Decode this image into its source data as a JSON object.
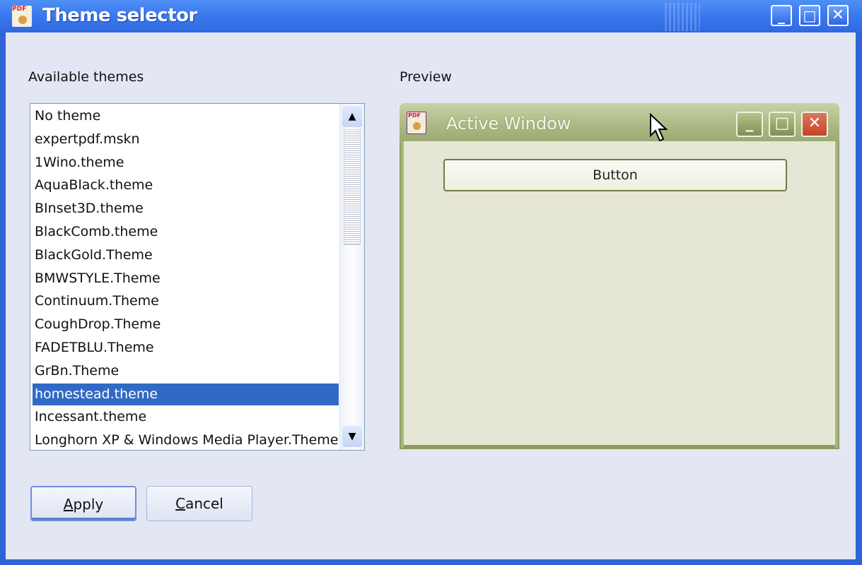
{
  "window": {
    "title": "Theme selector",
    "controls": {
      "minimize": "_",
      "maximize": "□",
      "close": "✕"
    }
  },
  "available_themes": {
    "label": "Available themes",
    "items": [
      "No theme",
      "expertpdf.mskn",
      "1Wino.theme",
      "AquaBlack.theme",
      "BInset3D.theme",
      "BlackComb.theme",
      "BlackGold.Theme",
      "BMWSTYLE.Theme",
      "Continuum.Theme",
      "CoughDrop.Theme",
      "FADETBLU.Theme",
      "GrBn.Theme",
      "homestead.theme",
      "Incessant.theme",
      "Longhorn XP & Windows Media Player.Theme"
    ],
    "selected_index": 12,
    "scroll_up": "▲",
    "scroll_down": "▼"
  },
  "preview": {
    "label": "Preview",
    "window_caption": "Active Window",
    "button_label": "Button",
    "controls": {
      "minimize": "_",
      "maximize": "□",
      "close": "✕"
    }
  },
  "buttons": {
    "apply": {
      "accesskey": "A",
      "rest": "pply"
    },
    "cancel": {
      "accesskey": "C",
      "rest": "ancel"
    }
  },
  "icon_text": {
    "pdf": "PDF"
  },
  "colors": {
    "titlebar": "#3d7cf0",
    "selection": "#316ac5",
    "preview_frame": "#a6b67d",
    "preview_close": "#c2452b"
  }
}
